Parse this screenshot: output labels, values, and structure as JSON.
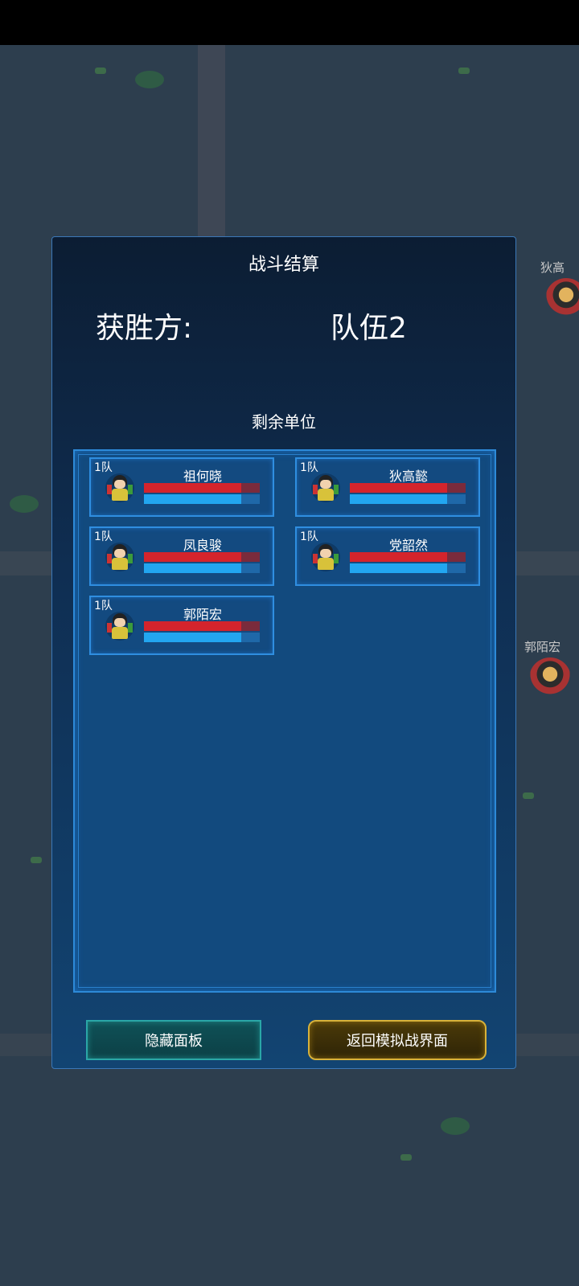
{
  "panel": {
    "title": "战斗结算",
    "winner_label": "获胜方:",
    "winner_value": "队伍2",
    "remaining_title": "剩余单位"
  },
  "units": [
    {
      "team": "1队",
      "name": "祖何晓",
      "hp": 0.84,
      "mp": 0.84
    },
    {
      "team": "1队",
      "name": "狄高懿",
      "hp": 0.84,
      "mp": 0.84
    },
    {
      "team": "1队",
      "name": "凤良骏",
      "hp": 0.84,
      "mp": 0.84
    },
    {
      "team": "1队",
      "name": "党韶然",
      "hp": 0.84,
      "mp": 0.84
    },
    {
      "team": "1队",
      "name": "郭陌宏",
      "hp": 0.84,
      "mp": 0.84
    }
  ],
  "buttons": {
    "hide_panel": "隐藏面板",
    "return_sim": "返回模拟战界面"
  },
  "map_units": [
    {
      "label": "狄高"
    },
    {
      "label": "郭陌宏"
    }
  ],
  "colors": {
    "hp": "#d4242c",
    "mp": "#22a6f0",
    "panel_border": "#3b78b8",
    "hide_button_border": "#2aa7a7",
    "return_button_border": "#d8b23a"
  }
}
